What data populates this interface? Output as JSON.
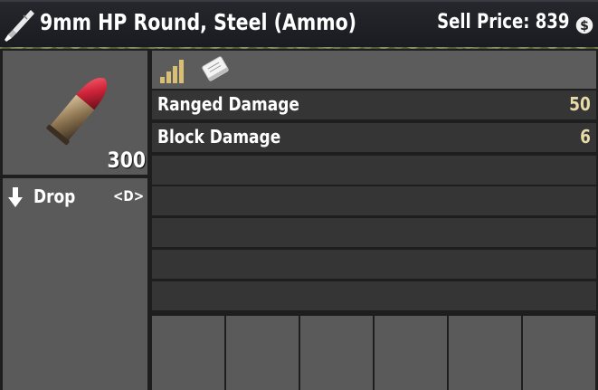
{
  "title": "9mm HP Round, Steel (Ammo)",
  "sell_price_label": "Sell Price: 839",
  "icons": {
    "title": "bullet-crafting-icon",
    "coin": "dollar-coin-icon",
    "quality": "signal-bars-icon",
    "info": "book-icon",
    "drop": "arrow-down-icon",
    "item": "pistol-bullet-icon"
  },
  "item": {
    "count": "300"
  },
  "actions": [
    {
      "label": "Drop",
      "key": "<D>"
    }
  ],
  "stats": [
    {
      "label": "Ranged Damage",
      "value": "50"
    },
    {
      "label": "Block Damage",
      "value": "6"
    }
  ],
  "colors": {
    "stat_value": "#e8d9a8",
    "quality_icon": "#d8bf73",
    "bullet_tip": "#d0243a",
    "title_bar": "#1e1f24"
  }
}
